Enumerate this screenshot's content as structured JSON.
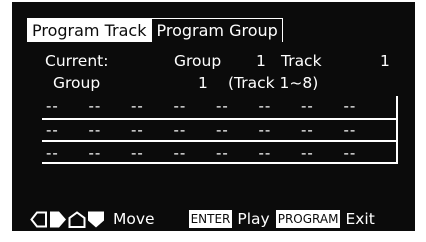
{
  "tabs": [
    {
      "label": "Program Track",
      "active": false
    },
    {
      "label": "Program Group",
      "active": true
    }
  ],
  "status": {
    "current_label": "Current:",
    "group_label": "Group",
    "group_value": "1",
    "track_label": "Track",
    "track_value": "1"
  },
  "group_info": {
    "label": "Group",
    "value": "1",
    "range": "(Track 1~8)"
  },
  "program_rows": [
    [
      "--",
      "--",
      "--",
      "--",
      "--",
      "--",
      "--",
      "--"
    ],
    [
      "--",
      "--",
      "--",
      "--",
      "--",
      "--",
      "--",
      "--"
    ],
    [
      "--",
      "--",
      "--",
      "--",
      "--",
      "--",
      "--",
      "--"
    ]
  ],
  "footer": {
    "arrow_icons": [
      "left-arrow-icon",
      "right-arrow-icon",
      "up-arrow-icon",
      "down-arrow-icon"
    ],
    "move_label": "Move",
    "enter_key": "ENTER",
    "enter_action": "Play",
    "program_key": "PROGRAM",
    "program_action": "Exit"
  },
  "colors": {
    "background": "#0b0b0b",
    "foreground": "#ffffff"
  }
}
